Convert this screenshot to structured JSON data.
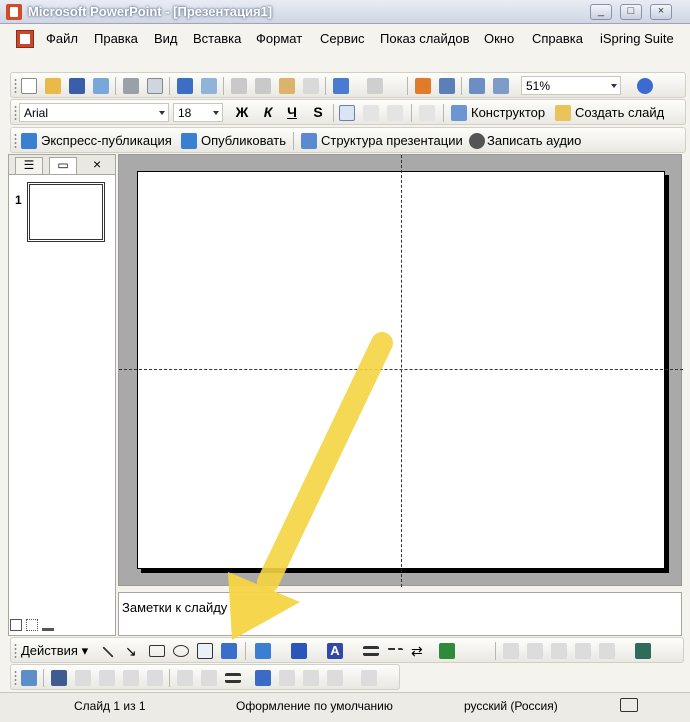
{
  "window": {
    "title": "Microsoft PowerPoint - [Презентация1]",
    "controls": [
      "_",
      "□",
      "×"
    ]
  },
  "menu": {
    "items": [
      {
        "label": "Файл",
        "accel": "Ф"
      },
      {
        "label": "Правка",
        "accel": "П"
      },
      {
        "label": "Вид",
        "accel": "В"
      },
      {
        "label": "Вставка",
        "accel": "с"
      },
      {
        "label": "Формат",
        "accel": "о"
      },
      {
        "label": "Сервис",
        "accel": "е"
      },
      {
        "label": "Показ слайдов",
        "accel": "к"
      },
      {
        "label": "Окно",
        "accel": "О"
      },
      {
        "label": "Справка",
        "accel": "С"
      },
      {
        "label": "iSpring Suite",
        "accel": ""
      }
    ]
  },
  "standard_toolbar": {
    "zoom": "51%"
  },
  "formatting_toolbar": {
    "font": "Arial",
    "size": "18",
    "bold": "Ж",
    "italic": "К",
    "underline": "Ч",
    "shadow": "S",
    "designer": "Конструктор",
    "new_slide": "Создать слайд"
  },
  "ispring_toolbar": {
    "express_publish": "Экспресс-публикация",
    "publish": "Опубликовать",
    "structure": "Структура презентации",
    "record_audio": "Записать аудио"
  },
  "slides_pane": {
    "slide_number": "1"
  },
  "notes": {
    "placeholder": "Заметки к слайду"
  },
  "drawing_toolbar": {
    "actions": "Действия"
  },
  "status": {
    "slide": "Слайд 1 из 1",
    "design": "Оформление по умолчанию",
    "language": "русский (Россия)"
  },
  "colors": {
    "arrow": "#f5d442",
    "slide_bg": "#ffffff",
    "workspace": "#a9a9a9"
  }
}
